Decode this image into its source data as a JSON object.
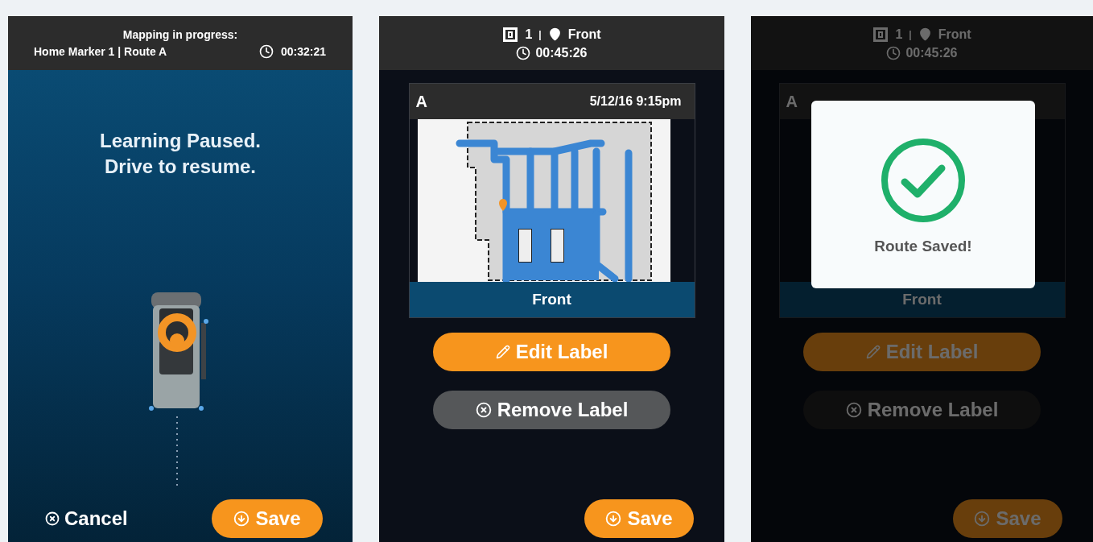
{
  "screens": [
    {
      "kind": "mapping",
      "header": {
        "title": "Mapping in progress:",
        "route": "Home Marker 1 | Route A",
        "timer": "00:32:21"
      },
      "message_lines": [
        "Learning Paused.",
        "Drive to resume."
      ],
      "actions": [
        {
          "kind": "cancel",
          "label": "Cancel"
        },
        {
          "kind": "save",
          "label": "Save"
        }
      ]
    },
    {
      "kind": "review",
      "dimmed": false,
      "header": {
        "marker": "1",
        "separator": "|",
        "location": "Front",
        "timer": "00:45:26"
      },
      "card": {
        "letter": "A",
        "date": "5/12/16 9:15pm",
        "label": "Front"
      },
      "buttons": [
        {
          "kind": "edit",
          "label": "Edit Label"
        },
        {
          "kind": "remove",
          "label": "Remove Label"
        }
      ],
      "save": {
        "label": "Save"
      }
    },
    {
      "kind": "review",
      "dimmed": true,
      "header": {
        "marker": "1",
        "separator": "|",
        "location": "Front",
        "timer": "00:45:26"
      },
      "card": {
        "letter": "A",
        "label": "Front"
      },
      "buttons": [
        {
          "kind": "edit",
          "label": "Edit Label"
        },
        {
          "kind": "remove",
          "label": "Remove Label"
        }
      ],
      "save": {
        "label": "Save"
      },
      "dialog": {
        "message": "Route Saved!"
      }
    }
  ]
}
